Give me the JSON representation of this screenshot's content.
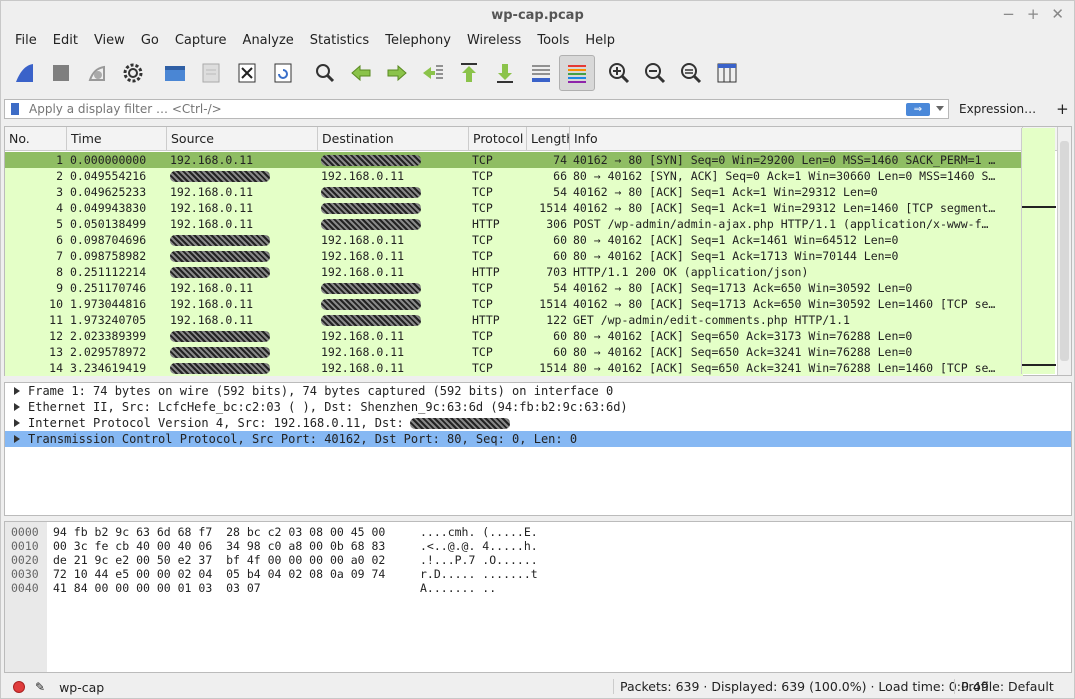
{
  "window": {
    "title": "wp-cap.pcap",
    "min": "−",
    "max": "+",
    "close": "✕"
  },
  "menu": [
    "File",
    "Edit",
    "View",
    "Go",
    "Capture",
    "Analyze",
    "Statistics",
    "Telephony",
    "Wireless",
    "Tools",
    "Help"
  ],
  "filter": {
    "placeholder": "Apply a display filter … <Ctrl-/>",
    "apply": "⇒",
    "expression": "Expression…",
    "add": "+"
  },
  "columns": [
    "No.",
    "Time",
    "Source",
    "Destination",
    "Protocol",
    "Length",
    "Info"
  ],
  "packets": [
    {
      "no": "1",
      "time": "0.000000000",
      "src": "192.168.0.11",
      "dst": "",
      "proto": "TCP",
      "len": "74",
      "info": "40162 → 80 [SYN] Seq=0 Win=29200 Len=0 MSS=1460 SACK_PERM=1 …"
    },
    {
      "no": "2",
      "time": "0.049554216",
      "src": "",
      "dst": "192.168.0.11",
      "proto": "TCP",
      "len": "66",
      "info": "80 → 40162 [SYN, ACK] Seq=0 Ack=1 Win=30660 Len=0 MSS=1460 S…"
    },
    {
      "no": "3",
      "time": "0.049625233",
      "src": "192.168.0.11",
      "dst": "",
      "proto": "TCP",
      "len": "54",
      "info": "40162 → 80 [ACK] Seq=1 Ack=1 Win=29312 Len=0"
    },
    {
      "no": "4",
      "time": "0.049943830",
      "src": "192.168.0.11",
      "dst": "",
      "proto": "TCP",
      "len": "1514",
      "info": "40162 → 80 [ACK] Seq=1 Ack=1 Win=29312 Len=1460 [TCP segment…"
    },
    {
      "no": "5",
      "time": "0.050138499",
      "src": "192.168.0.11",
      "dst": "",
      "proto": "HTTP",
      "len": "306",
      "info": "POST /wp-admin/admin-ajax.php HTTP/1.1  (application/x-www-f…"
    },
    {
      "no": "6",
      "time": "0.098704696",
      "src": "",
      "dst": "192.168.0.11",
      "proto": "TCP",
      "len": "60",
      "info": "80 → 40162 [ACK] Seq=1 Ack=1461 Win=64512 Len=0"
    },
    {
      "no": "7",
      "time": "0.098758982",
      "src": "",
      "dst": "192.168.0.11",
      "proto": "TCP",
      "len": "60",
      "info": "80 → 40162 [ACK] Seq=1 Ack=1713 Win=70144 Len=0"
    },
    {
      "no": "8",
      "time": "0.251112214",
      "src": "",
      "dst": "192.168.0.11",
      "proto": "HTTP",
      "len": "703",
      "info": "HTTP/1.1 200 OK  (application/json)"
    },
    {
      "no": "9",
      "time": "0.251170746",
      "src": "192.168.0.11",
      "dst": "",
      "proto": "TCP",
      "len": "54",
      "info": "40162 → 80 [ACK] Seq=1713 Ack=650 Win=30592 Len=0"
    },
    {
      "no": "10",
      "time": "1.973044816",
      "src": "192.168.0.11",
      "dst": "",
      "proto": "TCP",
      "len": "1514",
      "info": "40162 → 80 [ACK] Seq=1713 Ack=650 Win=30592 Len=1460 [TCP se…"
    },
    {
      "no": "11",
      "time": "1.973240705",
      "src": "192.168.0.11",
      "dst": "",
      "proto": "HTTP",
      "len": "122",
      "info": "GET /wp-admin/edit-comments.php HTTP/1.1"
    },
    {
      "no": "12",
      "time": "2.023389399",
      "src": "",
      "dst": "192.168.0.11",
      "proto": "TCP",
      "len": "60",
      "info": "80 → 40162 [ACK] Seq=650 Ack=3173 Win=76288 Len=0"
    },
    {
      "no": "13",
      "time": "2.029578972",
      "src": "",
      "dst": "192.168.0.11",
      "proto": "TCP",
      "len": "60",
      "info": "80 → 40162 [ACK] Seq=650 Ack=3241 Win=76288 Len=0"
    },
    {
      "no": "14",
      "time": "3.234619419",
      "src": "",
      "dst": "192.168.0.11",
      "proto": "TCP",
      "len": "1514",
      "info": "80 → 40162 [ACK] Seq=650 Ack=3241 Win=76288 Len=1460 [TCP se…"
    }
  ],
  "details": [
    "Frame 1: 74 bytes on wire (592 bits), 74 bytes captured (592 bits) on interface 0",
    "Ethernet II, Src: LcfcHefe_bc:c2:03 (                  ), Dst: Shenzhen_9c:63:6d (94:fb:b2:9c:63:6d)",
    "Internet Protocol Version 4, Src: 192.168.0.11, Dst:",
    "Transmission Control Protocol, Src Port: 40162, Dst Port: 80, Seq: 0, Len: 0"
  ],
  "hex": [
    {
      "off": "0000",
      "hex": "94 fb b2 9c 63 6d 68 f7  28 bc c2 03 08 00 45 00",
      "asc": "....cmh. (.....E."
    },
    {
      "off": "0010",
      "hex": "00 3c fe cb 40 00 40 06  34 98 c0 a8 00 0b 68 83",
      "asc": ".<..@.@. 4.....h."
    },
    {
      "off": "0020",
      "hex": "de 21 9c e2 00 50 e2 37  bf 4f 00 00 00 00 a0 02",
      "asc": ".!...P.7 .O......"
    },
    {
      "off": "0030",
      "hex": "72 10 44 e5 00 00 02 04  05 b4 04 02 08 0a 09 74",
      "asc": "r.D..... .......t"
    },
    {
      "off": "0040",
      "hex": "41 84 00 00 00 00 01 03  03 07",
      "asc": "A....... .."
    }
  ],
  "status": {
    "file": "wp-cap",
    "stats": "Packets: 639 · Displayed: 639 (100.0%) · Load time: 0:0.49",
    "profile": "Profile: Default"
  }
}
